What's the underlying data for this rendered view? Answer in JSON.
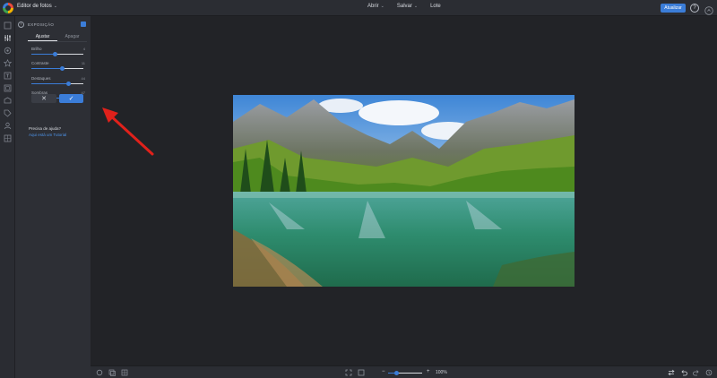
{
  "app": {
    "title": "Editor de fotos"
  },
  "topmenu": {
    "items": [
      {
        "label": "Abrir",
        "dropdown": true
      },
      {
        "label": "Salvar",
        "dropdown": true
      },
      {
        "label": "Lote",
        "dropdown": false
      }
    ],
    "upgrade_label": "Atualizar",
    "help_glyph": "?"
  },
  "colors": {
    "accent": "#3b7dd8",
    "annotation": "#e0211b"
  },
  "tools": {
    "items": [
      {
        "icon": "crop-icon"
      },
      {
        "icon": "adjust-sliders-icon",
        "active": true
      },
      {
        "icon": "effects-icon"
      },
      {
        "icon": "star-icon"
      },
      {
        "icon": "text-icon"
      },
      {
        "icon": "frame-icon"
      },
      {
        "icon": "shape-icon"
      },
      {
        "icon": "tag-icon"
      },
      {
        "icon": "person-icon"
      },
      {
        "icon": "texture-icon"
      }
    ]
  },
  "panel": {
    "title": "EXPOSIÇÃO",
    "tabs": [
      {
        "label": "Ajustar",
        "active": true
      },
      {
        "label": "Apagar",
        "active": false
      }
    ],
    "adjustments": [
      {
        "label": "Brilho",
        "value": "4",
        "level": 0.46
      },
      {
        "label": "Contraste",
        "value": "11",
        "level": 0.6
      },
      {
        "label": "Destaques",
        "value": "44",
        "level": 0.72
      },
      {
        "label": "Sombras",
        "value": "47",
        "level": 0.73
      }
    ],
    "cancel_glyph": "✕",
    "apply_glyph": "✓",
    "help": {
      "title": "Precisa de ajuda?",
      "link": "Aqui está um Tutorial"
    }
  },
  "bottombar": {
    "zoom_minus": "−",
    "zoom_plus": "+",
    "zoom_level": 0.25,
    "zoom_label": "100%"
  }
}
